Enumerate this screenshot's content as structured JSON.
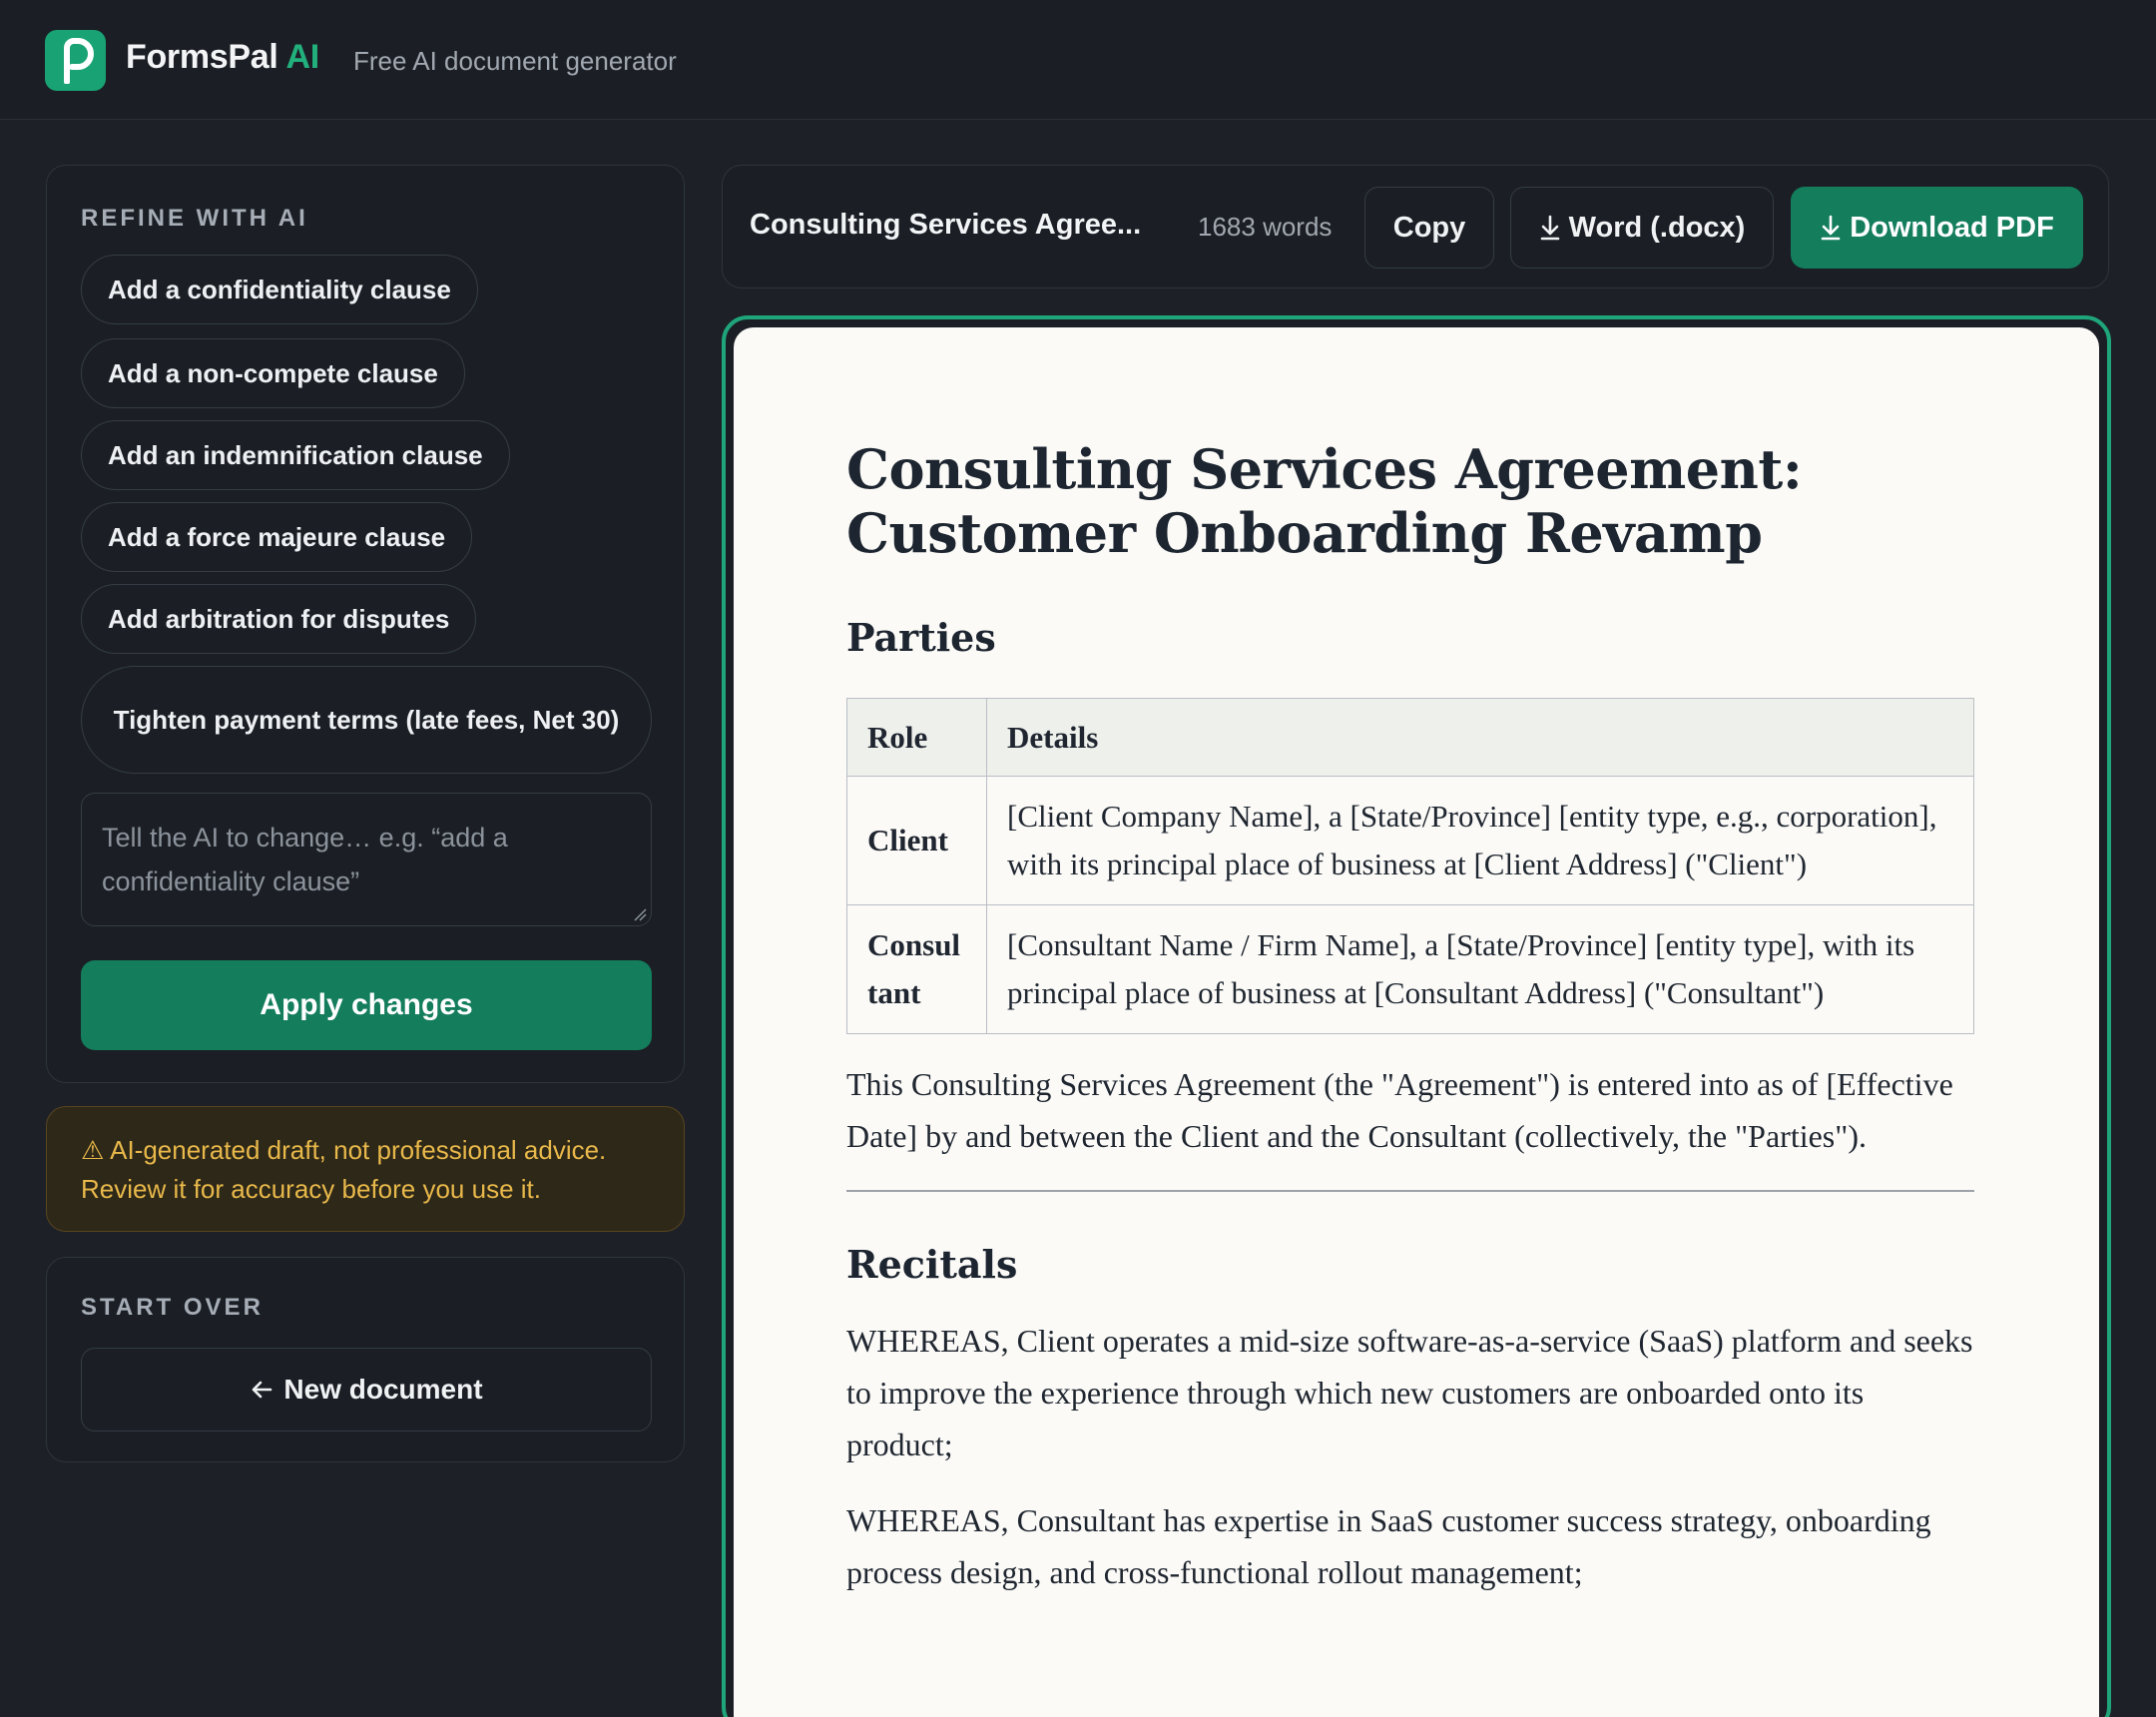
{
  "header": {
    "brand_name": "FormsPal",
    "brand_ai": "AI",
    "tagline": "Free AI document generator"
  },
  "sidebar": {
    "refine_title": "REFINE WITH AI",
    "suggestions": [
      "Add a confidentiality clause",
      "Add a non-compete clause",
      "Add an indemnification clause",
      "Add a force majeure clause",
      "Add arbitration for disputes",
      "Tighten payment terms (late fees, Net 30)"
    ],
    "instruction_placeholder": "Tell the AI to change… e.g. “add a confidentiality clause”",
    "apply_label": "Apply changes",
    "warning_text": "⚠ AI-generated draft, not professional advice. Review it for accuracy before you use it.",
    "start_over_title": "START OVER",
    "new_document_label": "New document"
  },
  "toolbar": {
    "doc_title": "Consulting Services Agree...",
    "word_count": "1683 words",
    "copy_label": "Copy",
    "word_label": "Word (.docx)",
    "pdf_label": "Download PDF"
  },
  "document": {
    "title_line1": "Consulting Services Agreement:",
    "title_line2": "Customer Onboarding Revamp",
    "parties_heading": "Parties",
    "table_headers": [
      "Role",
      "Details"
    ],
    "table_rows": [
      {
        "role": "Client",
        "details": "[Client Company Name], a [State/Province] [entity type, e.g., corporation], with its principal place of business at [Client Address] (\"Client\")"
      },
      {
        "role": "Consultant",
        "details": "[Consultant Name / Firm Name], a [State/Province] [entity type], with its principal place of business at [Consultant Address] (\"Consultant\")"
      }
    ],
    "intro_paragraph": "This Consulting Services Agreement (the \"Agreement\") is entered into as of [Effective Date] by and between the Client and the Consultant (collectively, the \"Parties\").",
    "recitals_heading": "Recitals",
    "recital_1": "WHEREAS, Client operates a mid-size software-as-a-service (SaaS) platform and seeks to improve the experience through which new customers are onboarded onto its product;",
    "recital_2": "WHEREAS, Consultant has expertise in SaaS customer success strategy, onboarding process design, and cross-functional rollout management;"
  },
  "colors": {
    "accent": "#137d5c",
    "brand_green": "#19a374",
    "warning": "#e8b84a",
    "background": "#1d2127"
  },
  "icons": [
    "formspal-logo-icon",
    "download-icon",
    "arrow-left-icon",
    "warning-icon",
    "resize-grip-icon"
  ]
}
